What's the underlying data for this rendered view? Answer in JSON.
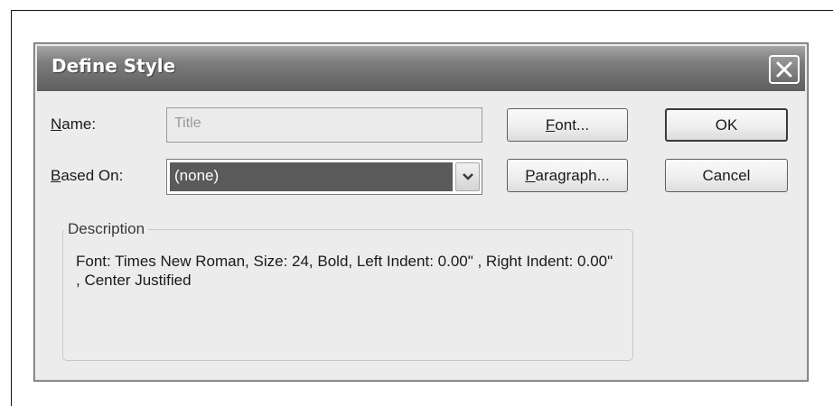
{
  "dialog": {
    "title": "Define Style",
    "close_icon": "close-icon"
  },
  "name": {
    "label_accel": "N",
    "label_rest": "ame:",
    "value": "Title"
  },
  "based_on": {
    "label_accel": "B",
    "label_rest": "ased On:",
    "selected": "(none)",
    "arrow_icon": "chevron-down-icon"
  },
  "buttons": {
    "font_accel": "F",
    "font_rest": "ont...",
    "paragraph_accel": "P",
    "paragraph_rest": "aragraph...",
    "ok": "OK",
    "cancel": "Cancel"
  },
  "description": {
    "legend": "Description",
    "text": "Font: Times New Roman, Size: 24, Bold, Left Indent: 0.00\" , Right Indent: 0.00\" , Center Justified"
  }
}
